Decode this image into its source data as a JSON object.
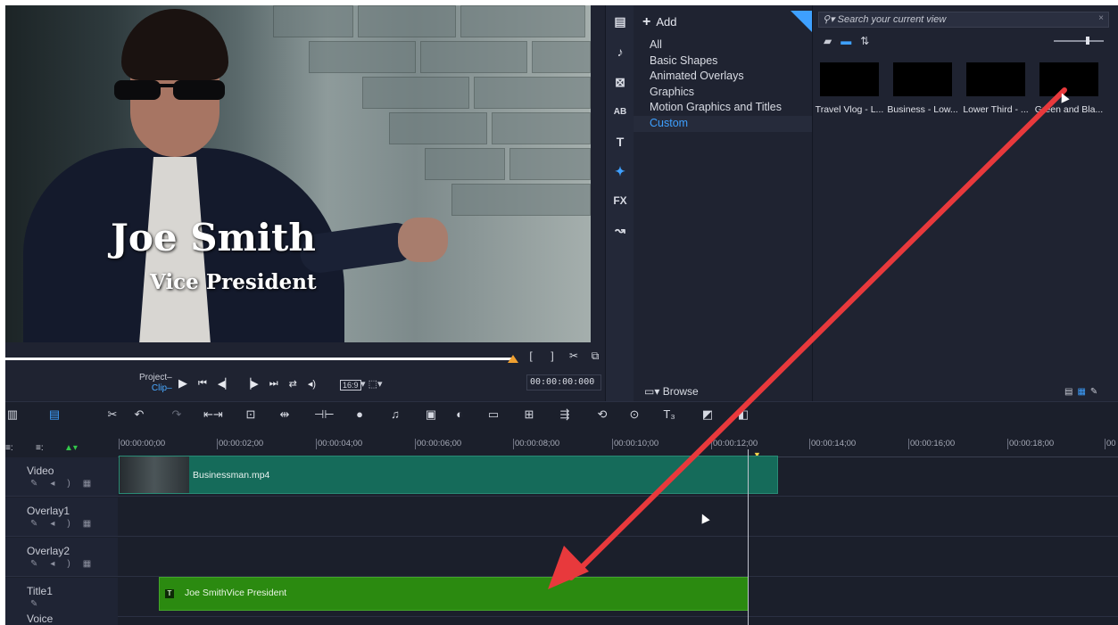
{
  "preview": {
    "title_name": "Joe Smith",
    "title_role": "Vice President",
    "mode_project": "Project",
    "mode_clip": "Clip",
    "aspect_ratio": "16:9",
    "timecode": "00:00:00:000",
    "trim_controls": [
      "[",
      "]"
    ]
  },
  "library": {
    "add_label": "Add",
    "categories": [
      "All",
      "Basic Shapes",
      "Animated Overlays",
      "Graphics",
      "Motion Graphics and Titles",
      "Custom"
    ],
    "selected_category": "Custom",
    "browse_label": "Browse",
    "side_icons": [
      "media-icon",
      "music-icon",
      "transition-icon",
      "ab-icon",
      "title-icon",
      "overlay-icon",
      "fx-icon",
      "path-icon"
    ],
    "fx_label": "FX",
    "title_glyph": "T"
  },
  "thumbnails": {
    "search_placeholder": "Search your current view",
    "items": [
      {
        "label": "Travel Vlog - L..."
      },
      {
        "label": "Business - Low..."
      },
      {
        "label": "Lower Third - ..."
      },
      {
        "label": "Green and Bla..."
      }
    ]
  },
  "timeline": {
    "ruler": [
      "00:00:00;00",
      "00:00:02;00",
      "00:00:04;00",
      "00:00:06;00",
      "00:00:08;00",
      "00:00:10;00",
      "00:00:12;00",
      "00:00:14;00",
      "00:00:16;00",
      "00:00:18;00",
      "00"
    ],
    "tracks": [
      {
        "name": "Video"
      },
      {
        "name": "Overlay1"
      },
      {
        "name": "Overlay2"
      },
      {
        "name": "Title1"
      },
      {
        "name": "Voice"
      }
    ],
    "video_clip": "Businessman.mp4",
    "title_clip": "Joe SmithVice President",
    "title_clip_glyph": "T"
  },
  "colors": {
    "accent": "#3ea0ff",
    "video_clip": "#156b5a",
    "title_clip": "#2b8a10",
    "annotation_arrow": "#e8393c"
  }
}
